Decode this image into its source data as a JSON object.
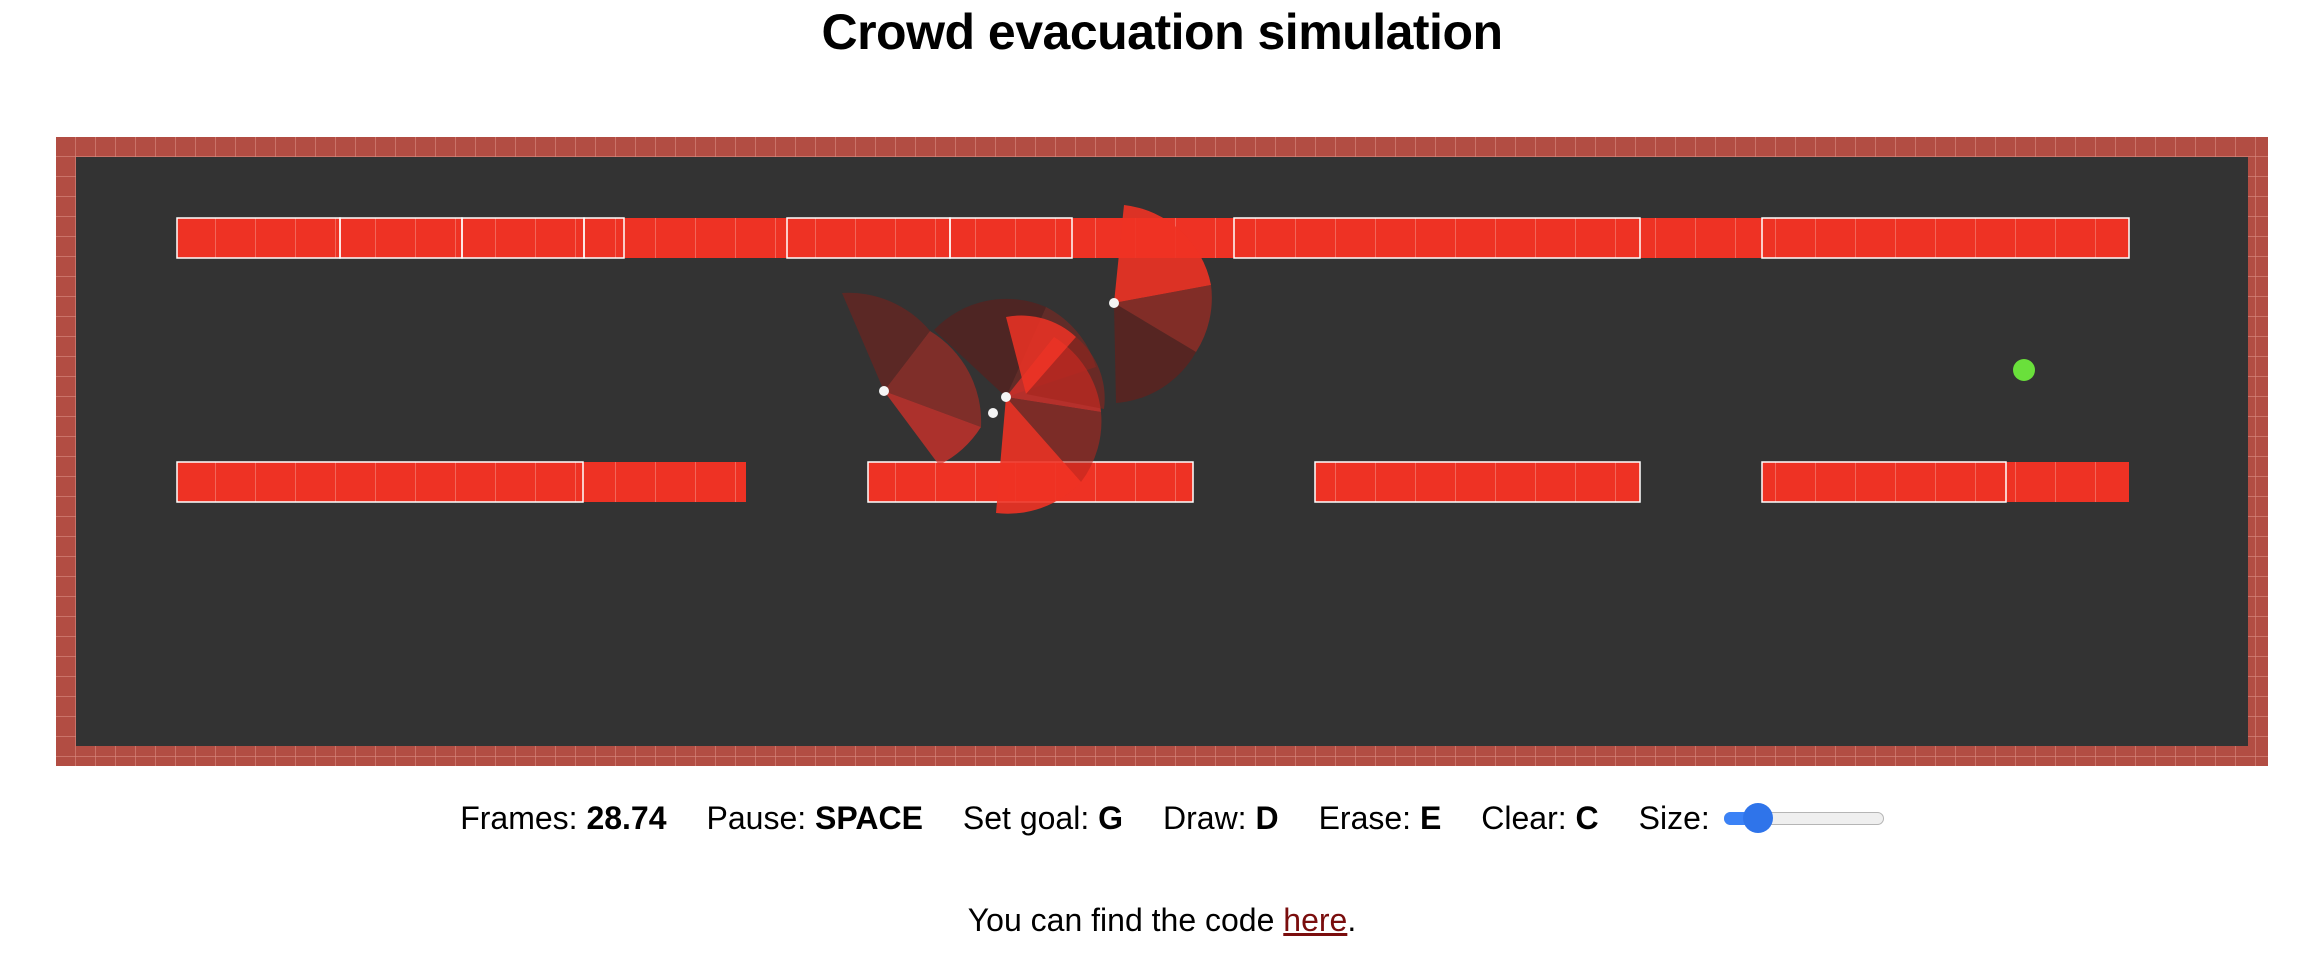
{
  "page": {
    "title": "Crowd evacuation simulation"
  },
  "controls": {
    "frames_label": "Frames:",
    "frames_value": "28.74",
    "pause_label": "Pause:",
    "pause_key": "SPACE",
    "set_goal_label": "Set goal:",
    "set_goal_key": "G",
    "draw_label": "Draw:",
    "draw_key": "D",
    "erase_label": "Erase:",
    "erase_key": "E",
    "clear_label": "Clear:",
    "clear_key": "C",
    "size_label": "Size:",
    "size_value_fraction": 0.15
  },
  "footer": {
    "prefix": "You can find the code",
    "link_text": "here",
    "suffix": "."
  },
  "colors": {
    "page_background": "#ffffff",
    "floor": "#333333",
    "border_wall": "#b24d43",
    "obstacle": "#ee3224",
    "goal": "#6ae03b",
    "agent": "#f5f5f5",
    "link": "#7a0d0d",
    "slider_accent": "#2f74ea"
  }
}
